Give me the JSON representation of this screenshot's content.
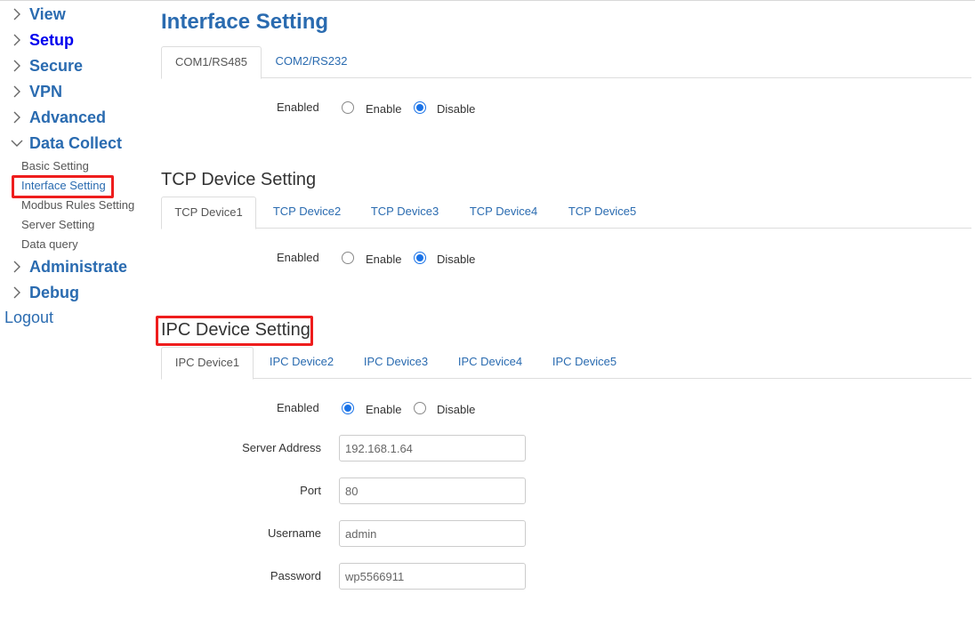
{
  "sidebar": {
    "items": [
      {
        "label": "View",
        "expanded": false
      },
      {
        "label": "Setup",
        "expanded": false
      },
      {
        "label": "Secure",
        "expanded": false
      },
      {
        "label": "VPN",
        "expanded": false
      },
      {
        "label": "Advanced",
        "expanded": false
      },
      {
        "label": "Data Collect",
        "expanded": true
      },
      {
        "label": "Administrate",
        "expanded": false
      },
      {
        "label": "Debug",
        "expanded": false
      }
    ],
    "data_collect_sub": [
      {
        "label": "Basic Setting"
      },
      {
        "label": "Interface Setting",
        "active": true
      },
      {
        "label": "Modbus Rules Setting"
      },
      {
        "label": "Server Setting"
      },
      {
        "label": "Data query"
      }
    ],
    "logout": "Logout"
  },
  "page": {
    "title": "Interface Setting"
  },
  "com_section": {
    "tabs": [
      "COM1/RS485",
      "COM2/RS232"
    ],
    "active_tab": 0,
    "enabled_label": "Enabled",
    "options": [
      "Enable",
      "Disable"
    ],
    "selected": "Disable"
  },
  "tcp_section": {
    "title": "TCP Device Setting",
    "tabs": [
      "TCP Device1",
      "TCP Device2",
      "TCP Device3",
      "TCP Device4",
      "TCP Device5"
    ],
    "active_tab": 0,
    "enabled_label": "Enabled",
    "options": [
      "Enable",
      "Disable"
    ],
    "selected": "Disable"
  },
  "ipc_section": {
    "title": "IPC Device Setting",
    "tabs": [
      "IPC Device1",
      "IPC Device2",
      "IPC Device3",
      "IPC Device4",
      "IPC Device5"
    ],
    "active_tab": 0,
    "enabled_label": "Enabled",
    "options": [
      "Enable",
      "Disable"
    ],
    "selected": "Enable",
    "fields": {
      "server_address": {
        "label": "Server Address",
        "value": "192.168.1.64"
      },
      "port": {
        "label": "Port",
        "value": "80"
      },
      "username": {
        "label": "Username",
        "value": "admin"
      },
      "password": {
        "label": "Password",
        "value": "wp5566911"
      }
    }
  },
  "colors": {
    "link": "#2a6bb0",
    "highlight": "#ee1d1d",
    "radio": "#1a73e8"
  }
}
